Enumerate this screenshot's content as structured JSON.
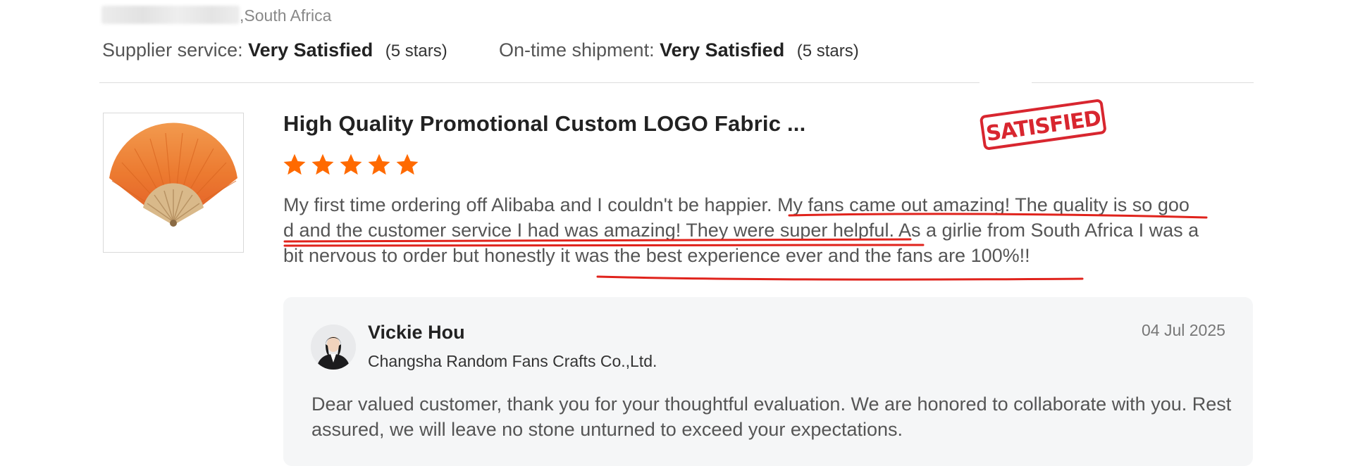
{
  "reviewer": {
    "country": ",South Africa"
  },
  "ratings": [
    {
      "label": "Supplier service:",
      "value": "Very Satisfied",
      "stars": "(5 stars)"
    },
    {
      "label": "On-time shipment:",
      "value": "Very Satisfied",
      "stars": "(5 stars)"
    }
  ],
  "product": {
    "title": "High Quality Promotional Custom LOGO Fabric ...",
    "rating": 5,
    "image_icon": "hand-fan-icon"
  },
  "stamp": {
    "text": "SATISFIED",
    "color": "#d8262f"
  },
  "review": {
    "text": "My first time ordering off Alibaba and I couldn't be happier. My fans came out amazing! The quality is so good and the customer service I had was amazing! They were super helpful. As a girlie from South Africa I was a bit nervous to order but honestly it was the best experience ever and the fans are 100%!!"
  },
  "reply": {
    "seller_name": "Vickie Hou",
    "company": "Changsha Random Fans Crafts Co.,Ltd.",
    "date": "04 Jul 2025",
    "text": "Dear valued customer, thank you for your thoughtful evaluation. We are honored to collaborate with you. Rest assured, we will leave no stone unturned to exceed your expectations."
  },
  "colors": {
    "star": "#ff6a00",
    "underline": "#e0231c",
    "reply_bg": "#f5f6f7"
  }
}
